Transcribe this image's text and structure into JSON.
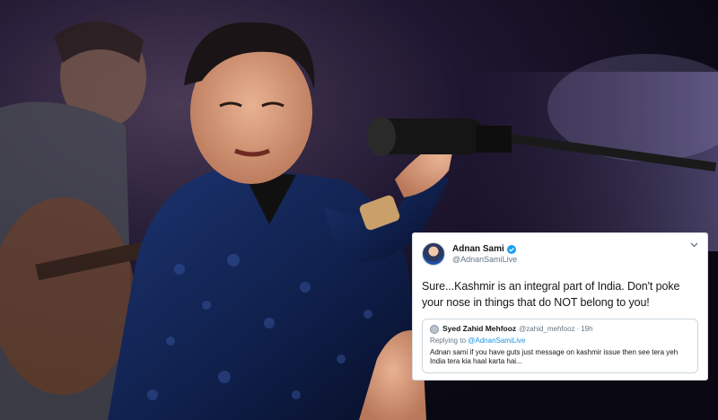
{
  "photo": {
    "icon": "concert-performer-photo"
  },
  "tweet": {
    "author_name": "Adnan Sami",
    "author_handle": "@AdnanSamiLive",
    "text": "Sure...Kashmir is an integral part of India. Don't poke your nose in things that do NOT belong to you!",
    "quoted": {
      "name": "Syed Zahid Mehfooz",
      "handle": "@zahid_mehfooz",
      "separator": "·",
      "time": "19h",
      "replying_prefix": "Replying to",
      "replying_to": "@AdnanSamiLive",
      "text": "Adnan sami if you have guts just message on kashmir issue then see tera yeh India tera kia haal karta hai..."
    },
    "colors": {
      "verified": "#1da1f2",
      "link": "#1b95e0"
    }
  }
}
